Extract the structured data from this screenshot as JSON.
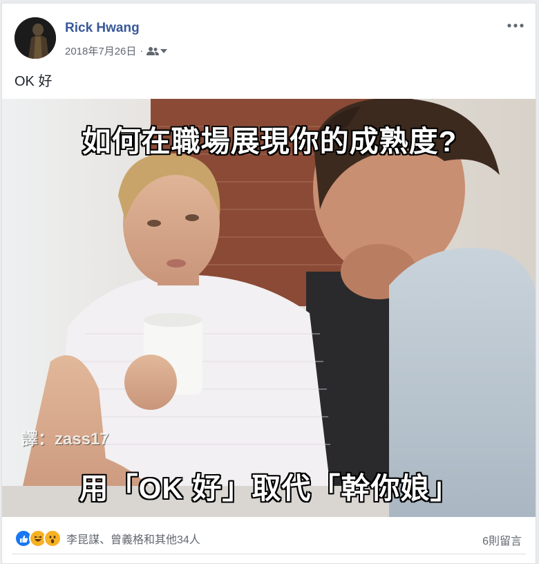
{
  "post": {
    "author": "Rick Hwang",
    "date": "2018年7月26日",
    "separator": "·",
    "text": "OK 好"
  },
  "photo": {
    "caption_top": "如何在職場展現你的成熟度?",
    "caption_bottom": "用「OK 好」取代「幹你娘」",
    "credit": "譯：zass17"
  },
  "footer": {
    "reactions": [
      "like-icon",
      "haha-icon",
      "wow-icon"
    ],
    "reaction_names": "李昆謀、曾義格和其他34人",
    "comments": "6則留言"
  },
  "colors": {
    "author_link": "#385898",
    "meta_text": "#616770",
    "like_blue": "#1877f2",
    "emoji_yellow": "#f7b125"
  }
}
